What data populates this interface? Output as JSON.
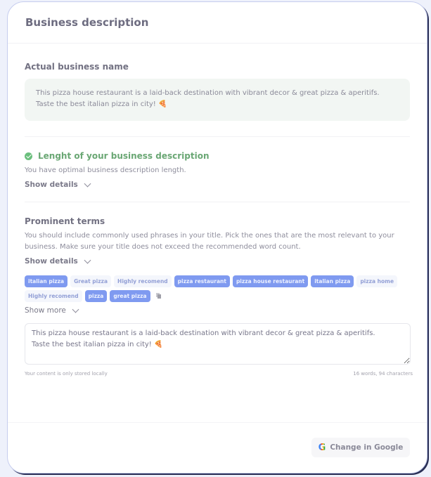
{
  "header": {
    "title": "Business description"
  },
  "actual_name": {
    "title": "Actual business name",
    "text": "This pizza house restaurant is a laid-back destination with vibrant decor & great pizza & aperitifs. Taste the best italian pizza in city! 🍕"
  },
  "length_check": {
    "status": "ok",
    "title": "Lenght of your business description",
    "message": "You have optimal business description length.",
    "show_details_label": "Show details"
  },
  "prominent_terms": {
    "title": "Prominent terms",
    "description": "You should include commonly used phrases in your title. Pick the ones that are the most relevant to your business. Make sure your title does not exceed the recommended word count.",
    "show_details_label": "Show details",
    "tags": [
      {
        "label": "italian pizza",
        "selected": true
      },
      {
        "label": "Great pizza",
        "selected": false
      },
      {
        "label": "Highly recomend",
        "selected": false
      },
      {
        "label": "pizza restaurant",
        "selected": true
      },
      {
        "label": "pizza house restaurant",
        "selected": true
      },
      {
        "label": "italian pizza",
        "selected": true
      },
      {
        "label": "pizza home",
        "selected": false
      },
      {
        "label": "Highly recomend",
        "selected": false
      },
      {
        "label": "pizza",
        "selected": true
      },
      {
        "label": "great pizza",
        "selected": true
      }
    ],
    "show_more_label": "Show more"
  },
  "editor": {
    "value": "This pizza house restaurant is a laid-back destination with vibrant decor & great pizza & aperitifs.\nTaste the best italian pizza in city! 🍕",
    "storage_note": "Your content is only stored locally",
    "counts": "16 words, 94 characters"
  },
  "footer": {
    "button_label": "Change in Google",
    "button_icon": "google-g-icon"
  },
  "colors": {
    "accent": "#7f9af0",
    "success": "#6bbf7d"
  }
}
